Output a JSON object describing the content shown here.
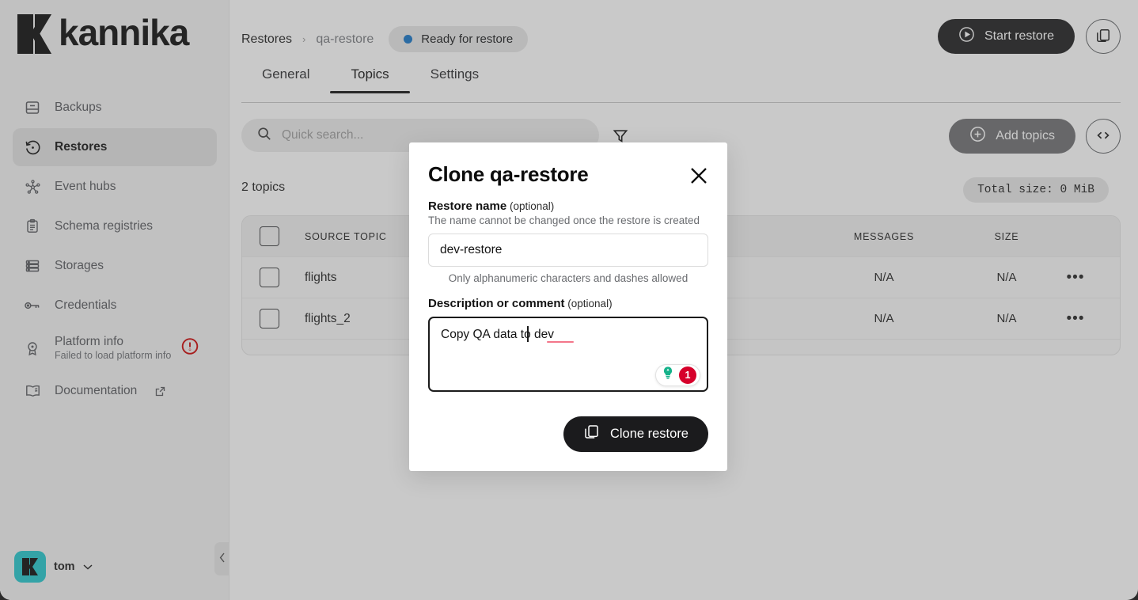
{
  "app": {
    "brand_name": "kannika",
    "accent_teal": "#21c6cd",
    "status_blue": "#1374c6",
    "alert_red": "#d6002a",
    "dark": "#1b1b1d"
  },
  "sidebar": {
    "items": [
      {
        "label": "Backups",
        "icon": "backup-icon",
        "active": false
      },
      {
        "label": "Restores",
        "icon": "restore-icon",
        "active": true
      },
      {
        "label": "Event hubs",
        "icon": "event-hub-icon",
        "active": false
      },
      {
        "label": "Schema registries",
        "icon": "clipboard-icon",
        "active": false
      },
      {
        "label": "Storages",
        "icon": "storage-icon",
        "active": false
      },
      {
        "label": "Credentials",
        "icon": "key-icon",
        "active": false
      },
      {
        "label": "Platform info",
        "sublabel": "Failed to load platform info",
        "icon": "platform-info-icon",
        "active": false,
        "warning": true
      },
      {
        "label": "Documentation",
        "icon": "book-icon",
        "active": false,
        "external": true
      }
    ],
    "user": {
      "name": "tom",
      "chevron": "⌄"
    },
    "collapse_chevron": "‹"
  },
  "header": {
    "breadcrumb": {
      "root": "Restores",
      "separator": "›",
      "leaf": "qa-restore"
    },
    "status": "Ready for restore",
    "start_restore_label": "Start restore",
    "clone_icon_label": "copy-icon"
  },
  "tabs": [
    {
      "label": "General",
      "active": false
    },
    {
      "label": "Topics",
      "active": true
    },
    {
      "label": "Settings",
      "active": false
    }
  ],
  "toolbar": {
    "search_placeholder": "Quick search...",
    "search_value": "",
    "filter_icon": "filter-icon",
    "add_topics_label": "Add topics",
    "code_view_icon": "code-brackets-icon"
  },
  "topics": {
    "count_label": "2 topics",
    "total_size_label": "Total size: 0 MiB",
    "columns": [
      "SOURCE TOPIC",
      "MESSAGES",
      "SIZE"
    ],
    "rows": [
      {
        "topic": "flights",
        "messages": "N/A",
        "size": "N/A",
        "menu": "•••"
      },
      {
        "topic": "flights_2",
        "messages": "N/A",
        "size": "N/A",
        "menu": "•••"
      }
    ]
  },
  "modal": {
    "title": "Clone qa-restore",
    "close_icon": "close-icon",
    "name_label": "Restore name",
    "name_optional": " (optional)",
    "name_help": "The name cannot be changed once the restore is created",
    "name_value": "dev-restore",
    "name_placeholder": "",
    "name_hint": "Only alphanumeric characters and dashes allowed",
    "desc_label": "Description or comment",
    "desc_optional": " (optional)",
    "desc_value": "Copy QA data to dev",
    "desc_placeholder": "",
    "grammar_count": "1",
    "submit_label": "Clone restore"
  }
}
